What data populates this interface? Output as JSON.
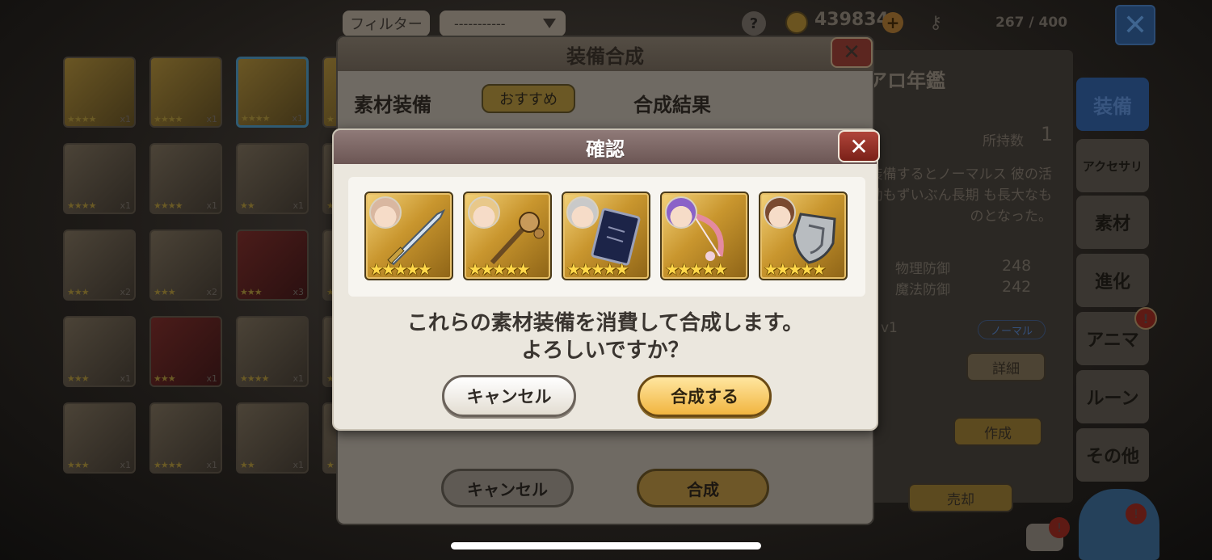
{
  "topbar": {
    "filter_label": "フィルター",
    "filter_value": "-----------",
    "help": "?",
    "gold": "439834",
    "gold_plus": "+",
    "slots": "267 / 400",
    "close": "✕"
  },
  "grid": {
    "cards": [
      {
        "stars": "★★★★",
        "count": "x1",
        "bg": "gold"
      },
      {
        "stars": "★★★★",
        "count": "x1",
        "bg": "gold"
      },
      {
        "stars": "★★★★",
        "count": "x1",
        "bg": "gold"
      },
      {
        "stars": "★",
        "count": "",
        "bg": "gold"
      },
      {
        "stars": "★★★★",
        "count": "x1",
        "bg": "dark"
      },
      {
        "stars": "★★★★",
        "count": "x1",
        "bg": "dark"
      },
      {
        "stars": "★★",
        "count": "x1",
        "bg": "dark"
      },
      {
        "stars": "★",
        "count": "",
        "bg": "dark"
      },
      {
        "stars": "★★★",
        "count": "x2",
        "bg": "dark"
      },
      {
        "stars": "★★★",
        "count": "x2",
        "bg": "dark"
      },
      {
        "stars": "★★★",
        "count": "x3",
        "bg": "red"
      },
      {
        "stars": "★",
        "count": "",
        "bg": "dark"
      },
      {
        "stars": "★★★",
        "count": "x1",
        "bg": "dark"
      },
      {
        "stars": "★★★",
        "count": "x1",
        "bg": "red"
      },
      {
        "stars": "★★★★",
        "count": "x1",
        "bg": "dark"
      },
      {
        "stars": "★",
        "count": "",
        "bg": "dark"
      },
      {
        "stars": "★★★",
        "count": "x1",
        "bg": "dark"
      },
      {
        "stars": "★★★★",
        "count": "x1",
        "bg": "dark"
      },
      {
        "stars": "★★",
        "count": "x1",
        "bg": "dark"
      },
      {
        "stars": "★",
        "count": "",
        "bg": "dark"
      }
    ]
  },
  "right_panel": {
    "title": "アロ年鑑",
    "owned_label": "所持数",
    "owned_value": "1",
    "description": "装備するとノーマルス 彼の活動もずいぶん長期 も長大なものとなった。",
    "phys_def_label": "物理防御",
    "phys_def_value": "248",
    "mag_def_label": "魔法防御",
    "mag_def_value": "242",
    "level": "v1",
    "rarity_badge": "ノーマル",
    "detail_btn": "詳細",
    "create_btn": "作成",
    "sell_btn": "売却"
  },
  "side_tabs": [
    {
      "label": "装備",
      "active": true
    },
    {
      "label": "アクセサリ",
      "active": false
    },
    {
      "label": "素材",
      "active": false
    },
    {
      "label": "進化",
      "active": false
    },
    {
      "label": "アニマ",
      "active": false,
      "notif": "!"
    },
    {
      "label": "ルーン",
      "active": false
    },
    {
      "label": "その他",
      "active": false
    }
  ],
  "corner": {
    "chat_notif": "!",
    "bot_notif": "!"
  },
  "synth_panel": {
    "title": "装備合成",
    "close": "✕",
    "materials_label": "素材装備",
    "recommend_btn": "おすすめ",
    "result_label": "合成結果",
    "cancel_btn": "キャンセル",
    "ok_btn": "合成"
  },
  "confirm": {
    "title": "確認",
    "close": "✕",
    "items": [
      {
        "stars": "★★★★★",
        "weapon": "sword-icon",
        "hair": "#d9b7a0"
      },
      {
        "stars": "★★★★★",
        "weapon": "staff-icon",
        "hair": "#e8c88a"
      },
      {
        "stars": "★★★★★",
        "weapon": "book-icon",
        "hair": "#c9c9c9"
      },
      {
        "stars": "★★★★★",
        "weapon": "bow-icon",
        "hair": "#8a62c8"
      },
      {
        "stars": "★★★★★",
        "weapon": "shield-icon",
        "hair": "#7a4a30"
      }
    ],
    "message_line1": "これらの素材装備を消費して合成します。",
    "message_line2": "よろしいですか？",
    "cancel_btn": "キャンセル",
    "ok_btn": "合成する"
  },
  "colors": {
    "accent_gold": "#f1b540",
    "dialog_bg": "#ebe7de",
    "header_mauve": "#7d6664"
  }
}
